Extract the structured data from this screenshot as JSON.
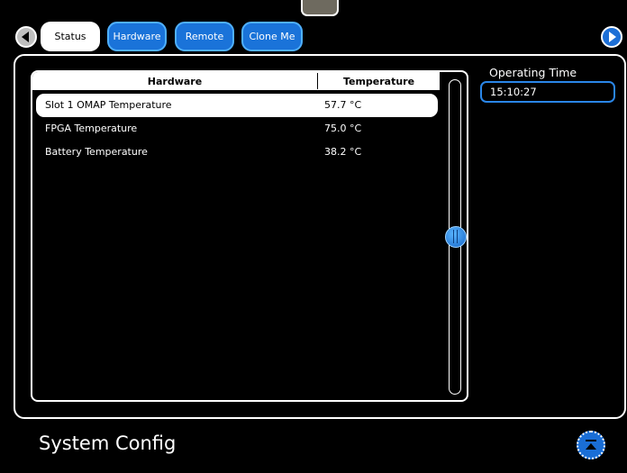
{
  "tabs": [
    {
      "label": "Status",
      "active": true
    },
    {
      "label": "Hardware",
      "active": false
    },
    {
      "label": "Remote",
      "active": false
    },
    {
      "label": "Clone Me",
      "active": false
    }
  ],
  "table": {
    "headers": {
      "hardware": "Hardware",
      "temperature": "Temperature"
    },
    "rows": [
      {
        "name": "Slot 1 OMAP Temperature",
        "value": "57.7 °C",
        "selected": true
      },
      {
        "name": "FPGA Temperature",
        "value": "75.0 °C",
        "selected": false
      },
      {
        "name": "Battery Temperature",
        "value": "38.2 °C",
        "selected": false
      }
    ]
  },
  "operating_time": {
    "label": "Operating Time",
    "value": "15:10:27"
  },
  "page_title": "System Config",
  "icons": {
    "back": "left-arrow-icon",
    "forward": "right-arrow-icon",
    "collapse": "collapse-up-icon",
    "handle": "top-drawer-handle"
  },
  "colors": {
    "accent": "#1a73d9",
    "background": "#000000",
    "selected": "#ffffff"
  }
}
